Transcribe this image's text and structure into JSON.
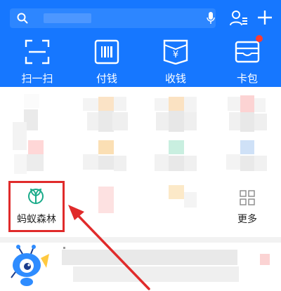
{
  "header": {
    "quick_actions": [
      {
        "label": "扫一扫",
        "icon": "scan-icon"
      },
      {
        "label": "付钱",
        "icon": "barcode-icon"
      },
      {
        "label": "收钱",
        "icon": "yuan-icon"
      },
      {
        "label": "卡包",
        "icon": "card-wallet-icon"
      }
    ],
    "colors": {
      "background": "#1677ff",
      "badge": "#ff3b30"
    }
  },
  "apps": {
    "forest": {
      "label": "蚂蚁森林",
      "icon": "sprout-icon",
      "icon_color": "#1aab8a"
    },
    "more": {
      "label": "更多",
      "icon": "grid-icon"
    }
  },
  "annotation": {
    "highlight_color": "#e02b2b",
    "arrow_color": "#e02b2b"
  }
}
